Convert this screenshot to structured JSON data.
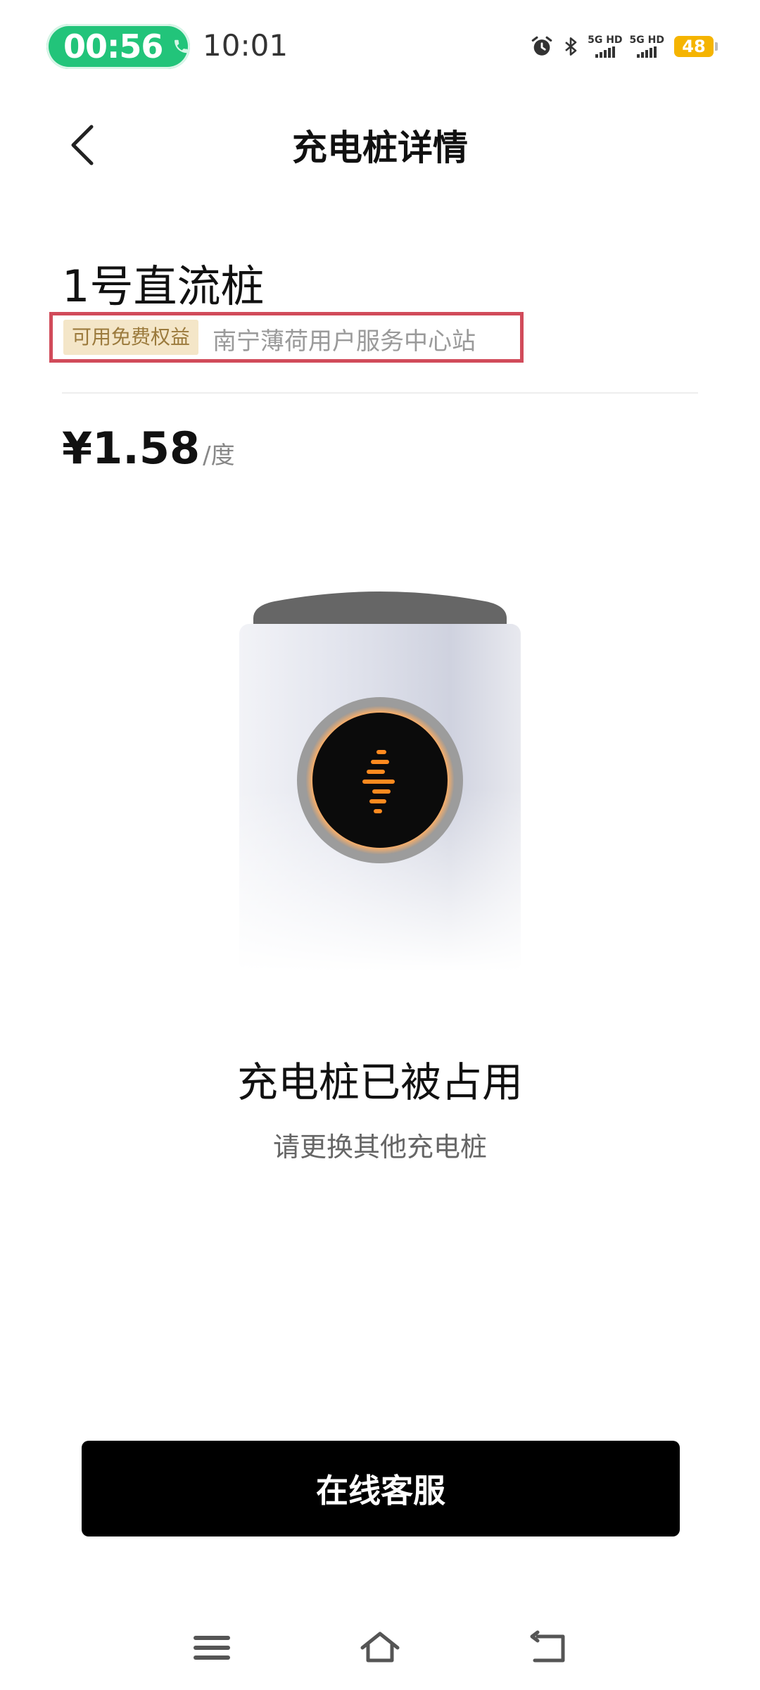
{
  "status_bar": {
    "call_timer": "00:56",
    "clock": "10:01",
    "network_1": "5G HD",
    "network_2": "5G HD",
    "battery": "48",
    "icons": [
      "alarm-icon",
      "bluetooth-icon",
      "signal-icon",
      "battery-icon"
    ]
  },
  "header": {
    "title": "充电桩详情",
    "back_icon": "chevron-left-icon"
  },
  "pile": {
    "name": "1号直流桩",
    "benefit_tag": "可用免费权益",
    "station": "南宁薄荷用户服务中心站"
  },
  "price": {
    "amount": "¥1.58",
    "unit": "/度"
  },
  "illustration": {
    "icon": "charger-pile-icon",
    "accent_color": "#ff8a1f"
  },
  "status": {
    "title": "充电桩已被占用",
    "subtitle": "请更换其他充电桩"
  },
  "actions": {
    "service_button": "在线客服"
  },
  "navbar": {
    "icons": [
      "menu-icon",
      "home-icon",
      "back-icon"
    ]
  },
  "colors": {
    "call_pill": "#22c47a",
    "highlight_border": "#d14b5a",
    "tag_bg": "#f4e6c8",
    "tag_text": "#9b7a3c",
    "button_bg": "#000000",
    "battery": "#f5b400"
  }
}
